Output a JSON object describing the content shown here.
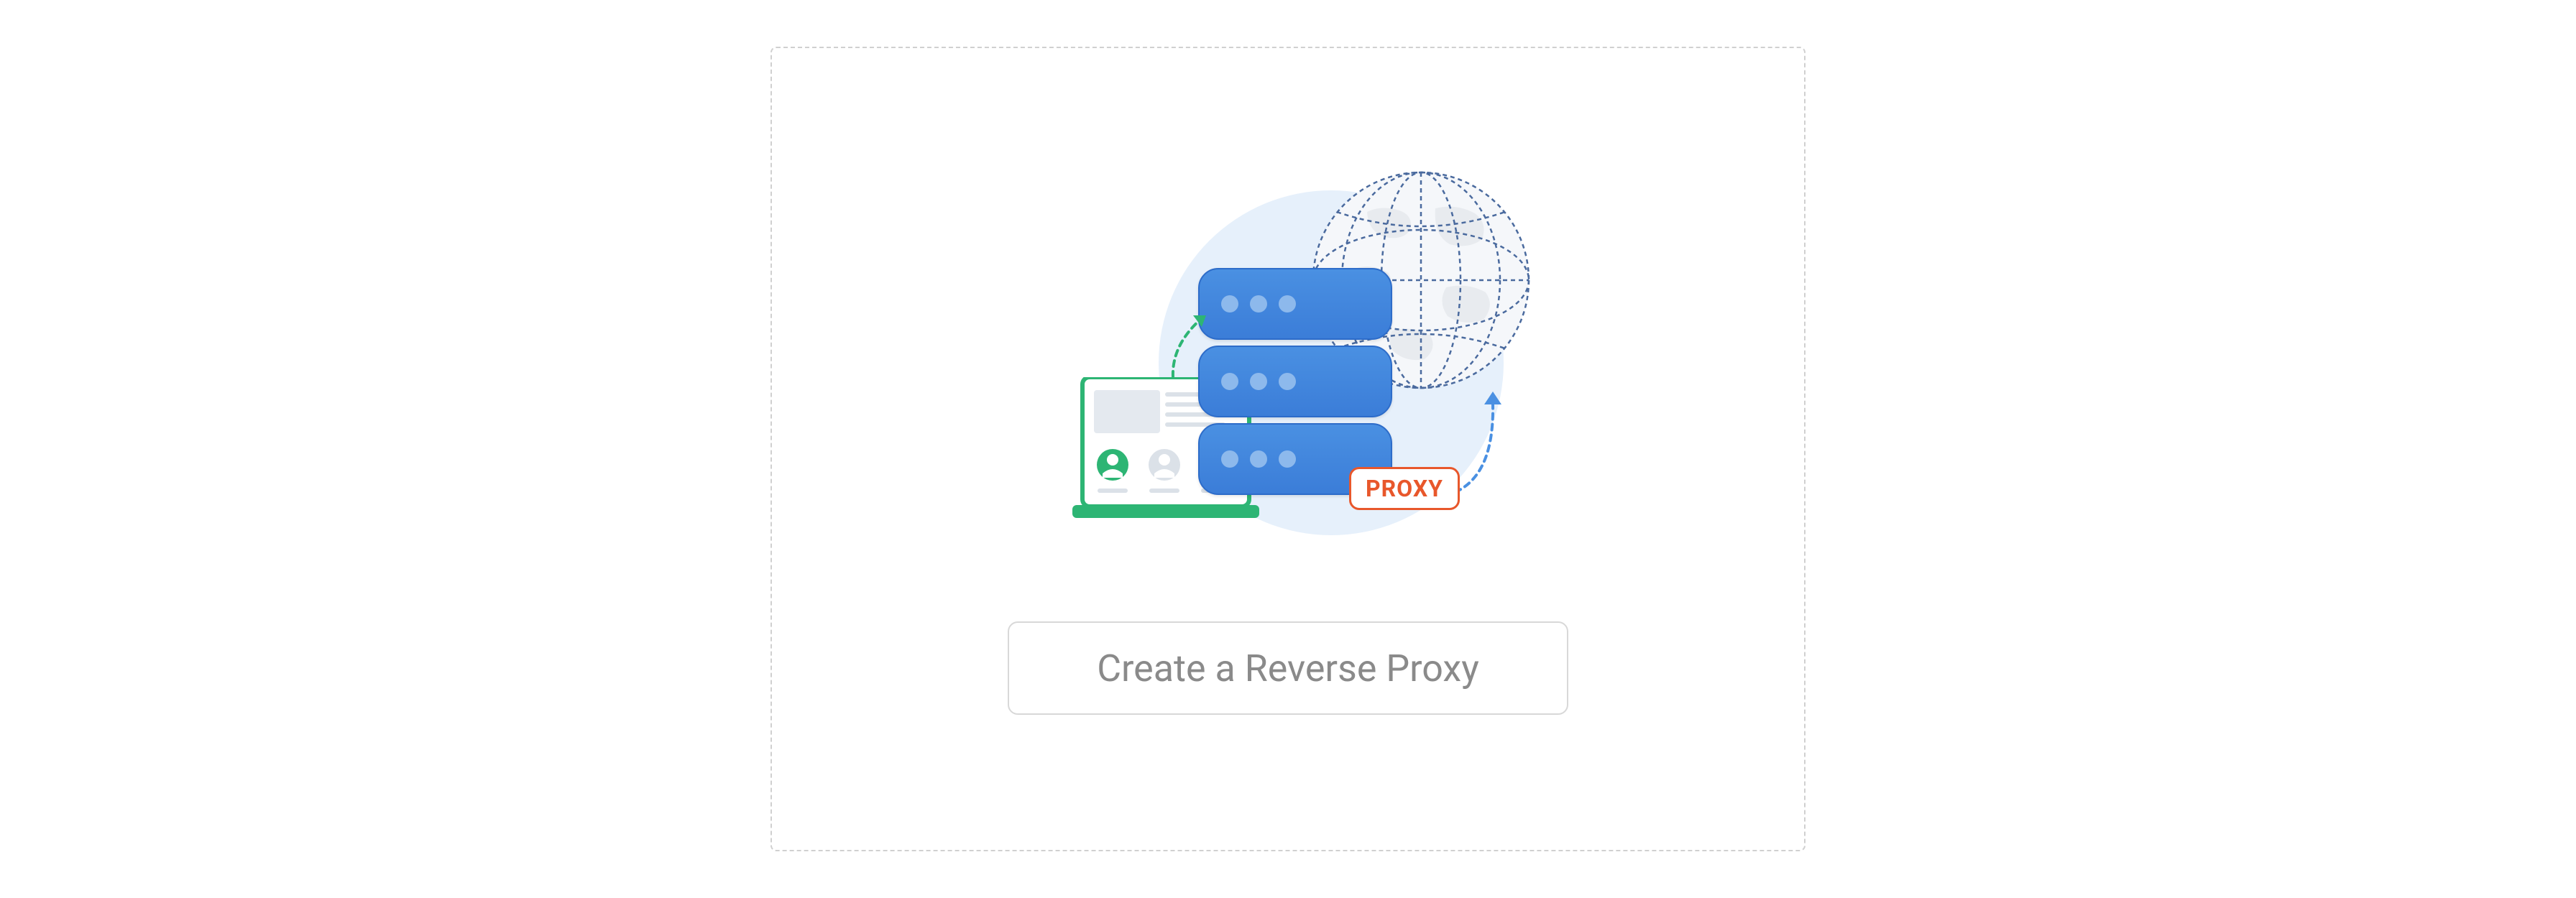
{
  "card": {
    "button_label": "Create a Reverse Proxy",
    "badge_label": "PROXY"
  }
}
